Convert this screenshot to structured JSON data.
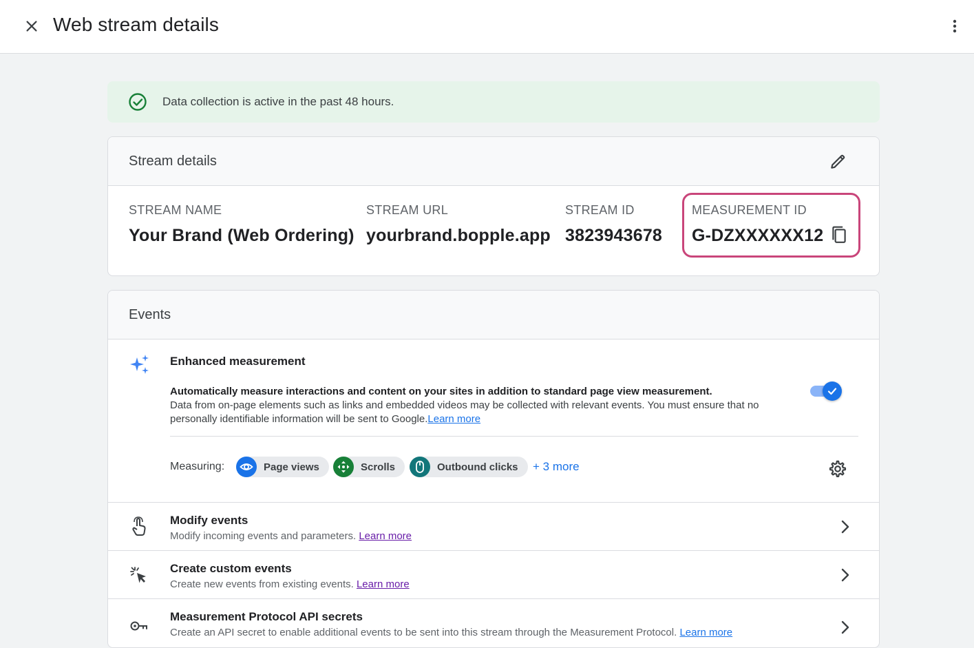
{
  "header": {
    "title": "Web stream details"
  },
  "banner": {
    "text": "Data collection is active in the past 48 hours.",
    "icon": "check-circle-icon",
    "color": "#e6f4ea"
  },
  "stream_details": {
    "title": "Stream details",
    "fields": [
      {
        "label": "STREAM NAME",
        "value": "Your Brand (Web Ordering)"
      },
      {
        "label": "STREAM URL",
        "value": "yourbrand.bopple.app"
      },
      {
        "label": "STREAM ID",
        "value": "3823943678"
      },
      {
        "label": "MEASUREMENT ID",
        "value": "G-DZXXXXXX12"
      }
    ],
    "highlight_color": "#c9457a"
  },
  "events": {
    "title": "Events",
    "enhanced": {
      "title": "Enhanced measurement",
      "desc_bold": "Automatically measure interactions and content on your sites in addition to standard page view measurement.",
      "desc": "Data from on-page elements such as links and embedded videos may be collected with relevant events. You must ensure that no personally identifiable information will be sent to Google.",
      "learn_more": "Learn more",
      "toggle_on": true,
      "measuring_label": "Measuring:",
      "chips": [
        {
          "label": "Page views",
          "icon": "eye-icon",
          "color": "#1a73e8"
        },
        {
          "label": "Scrolls",
          "icon": "scroll-arrows-icon",
          "color": "#188038"
        },
        {
          "label": "Outbound clicks",
          "icon": "mouse-icon",
          "color": "#12767a"
        }
      ],
      "more": "+ 3 more"
    },
    "rows": [
      {
        "title": "Modify events",
        "desc": "Modify incoming events and parameters.",
        "link": "Learn more"
      },
      {
        "title": "Create custom events",
        "desc": "Create new events from existing events.",
        "link": "Learn more"
      },
      {
        "title": "Measurement Protocol API secrets",
        "desc": "Create an API secret to enable additional events to be sent into this stream through the Measurement Protocol.",
        "link": "Learn more"
      }
    ]
  }
}
